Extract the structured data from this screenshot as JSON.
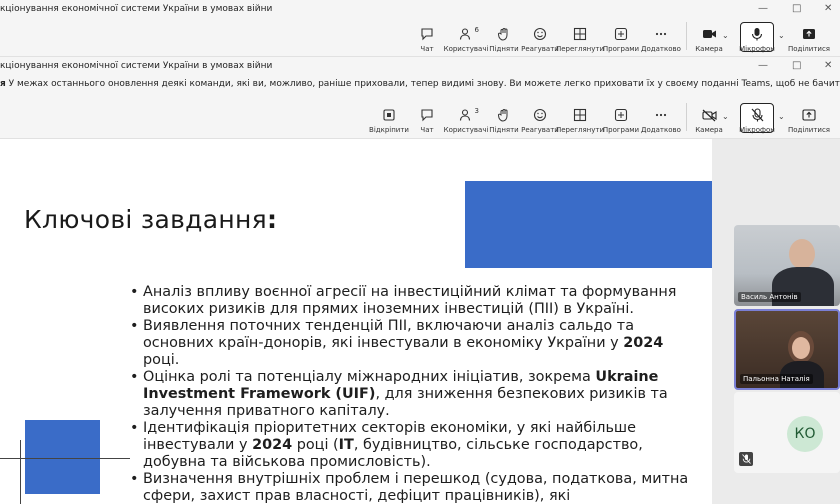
{
  "window1": {
    "title": "кціонування економічної системи України в умовах війни",
    "controls": [
      "—",
      "□",
      "✕"
    ]
  },
  "toolbar1": {
    "items": [
      {
        "label": "Чат",
        "icon": "chat-icon"
      },
      {
        "label": "Користувачі",
        "icon": "people-icon",
        "count": "6"
      },
      {
        "label": "Підняти",
        "icon": "raise-hand-icon"
      },
      {
        "label": "Реагувати",
        "icon": "smile-icon"
      },
      {
        "label": "Переглянути",
        "icon": "view-grid-icon"
      },
      {
        "label": "Програми",
        "icon": "apps-icon"
      },
      {
        "label": "Додатково",
        "icon": "more-icon"
      }
    ],
    "camera": "Камера",
    "mic": "Мікрофон",
    "share": "Поділитися"
  },
  "window2": {
    "title": "кціонування економічної системи України в умовах війни",
    "controls": [
      "—",
      "□",
      "✕"
    ]
  },
  "notice": {
    "bold": "я",
    "text": " У межах останнього оновлення деякі команди, які ви, можливо, раніше приховали, тепер видимі знову. Ви можете легко приховати їх у своєму поданні Teams, щоб не бачити їх."
  },
  "toolbar2": {
    "items": [
      {
        "label": "Відкріпити",
        "icon": "unpin-icon"
      },
      {
        "label": "Чат",
        "icon": "chat-icon"
      },
      {
        "label": "Користувачі",
        "icon": "people-icon",
        "count": "3"
      },
      {
        "label": "Підняти",
        "icon": "raise-hand-icon"
      },
      {
        "label": "Реагувати",
        "icon": "smile-icon"
      },
      {
        "label": "Переглянути",
        "icon": "view-grid-icon"
      },
      {
        "label": "Програми",
        "icon": "apps-icon"
      },
      {
        "label": "Додатково",
        "icon": "more-icon"
      }
    ],
    "camera": "Камера",
    "mic": "Мікрофон",
    "share": "Поділитися"
  },
  "slide": {
    "title": "Ключові завдання",
    "title_colon": ":",
    "bullets": [
      {
        "parts": [
          {
            "t": "Аналіз впливу воєнної агресії на інвестиційний клімат та формування високих ризиків для прямих іноземних інвестицій (ПІІ) в Україні."
          }
        ]
      },
      {
        "parts": [
          {
            "t": "Виявлення поточних тенденцій ПІІ, включаючи аналіз сальдо та основних країн-донорів, які інвестували в економіку України у "
          },
          {
            "b": "2024"
          },
          {
            "t": " році."
          }
        ]
      },
      {
        "parts": [
          {
            "t": "Оцінка ролі та потенціалу міжнародних ініціатив, зокрема "
          },
          {
            "b": "Ukraine Investment Framework (UIF)"
          },
          {
            "t": ", для зниження безпекових ризиків та залучення приватного капіталу."
          }
        ]
      },
      {
        "parts": [
          {
            "t": "Ідентифікація пріоритетних секторів економіки, у які найбільше інвестували у "
          },
          {
            "b": "2024"
          },
          {
            "t": " році ("
          },
          {
            "b": "IT"
          },
          {
            "t": ", будівництво, сільське господарство, добувна та військова промисловість)."
          }
        ]
      },
      {
        "parts": [
          {
            "t": "Визначення внутрішніх проблем і перешкод (судова, податкова, митна сфери, захист прав власності, дефіцит працівників), які"
          }
        ]
      }
    ]
  },
  "participants": [
    {
      "name": "Василь Антонів"
    },
    {
      "name": "Пальонна Наталія"
    },
    {
      "initials": "КО"
    }
  ]
}
